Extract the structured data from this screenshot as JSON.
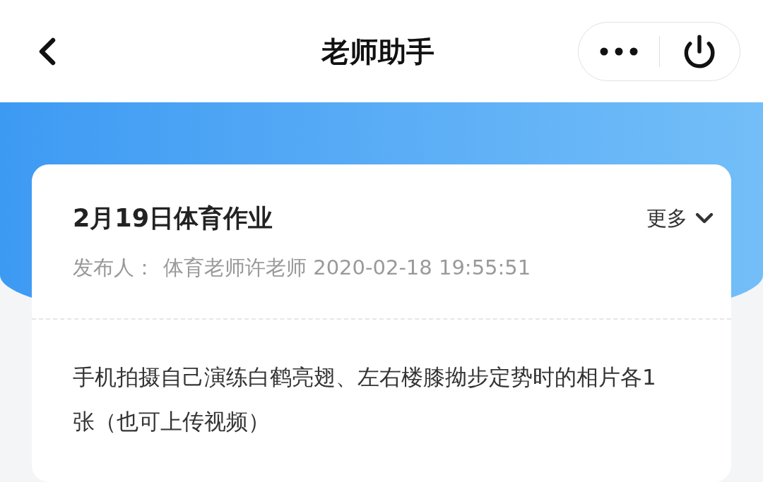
{
  "header": {
    "title": "老师助手"
  },
  "card": {
    "title": "2月19日体育作业",
    "more": "更多",
    "publisher_label": "发布人：",
    "publisher": "体育老师许老师 2020-02-18 19:55:51",
    "body": "手机拍摄自己演练白鹤亮翅、左右楼膝拗步定势时的相片各1张（也可上传视频）"
  }
}
